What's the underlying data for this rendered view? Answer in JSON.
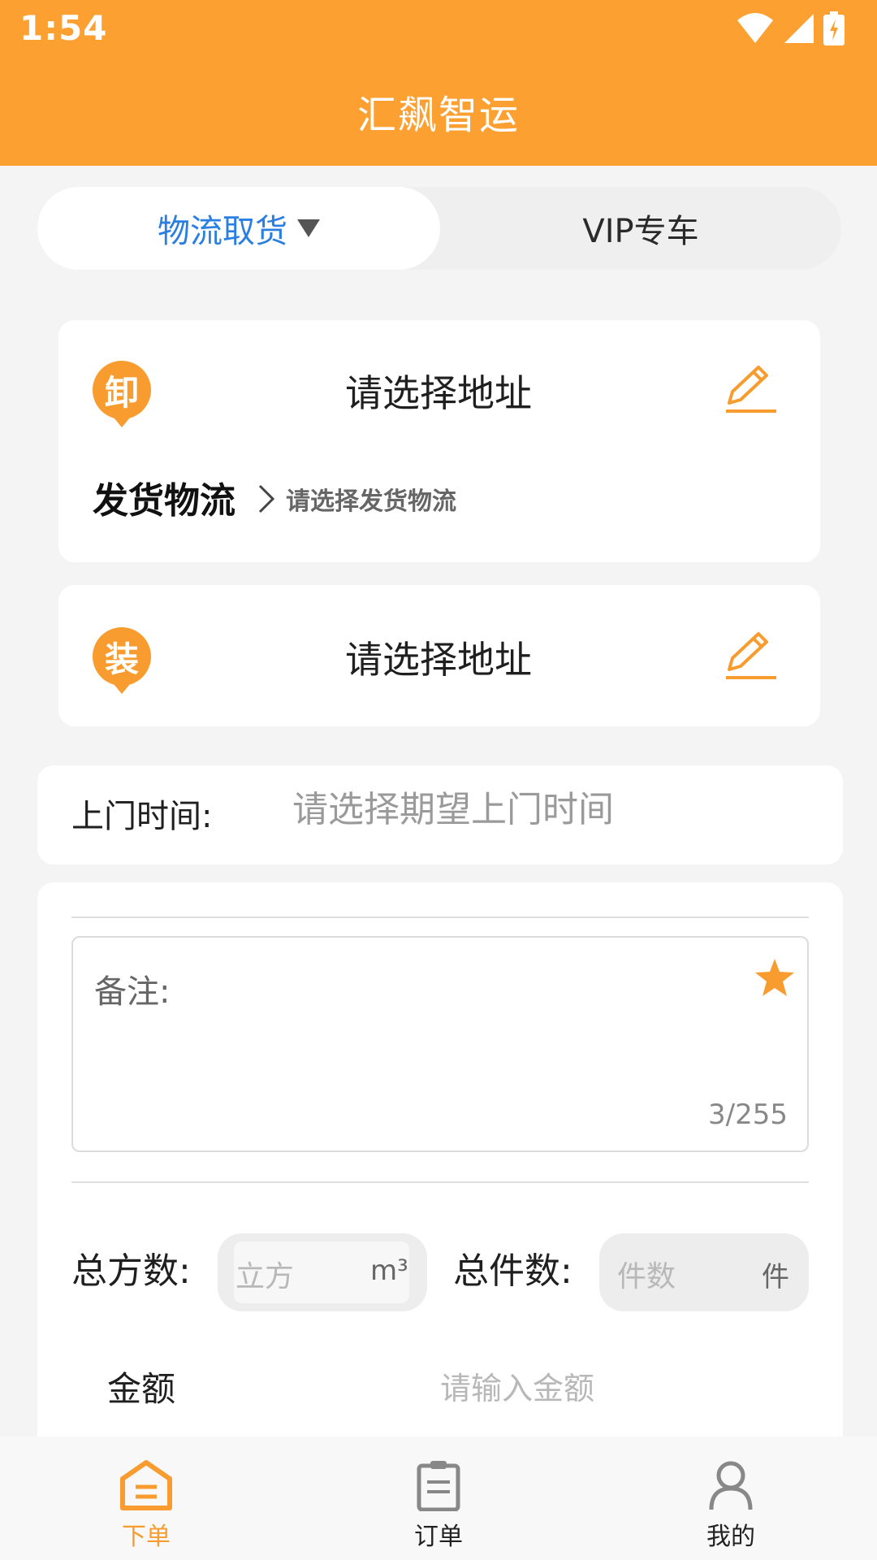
{
  "status_bar": {
    "time": "1:54"
  },
  "app": {
    "title": "汇飙智运"
  },
  "mode_tabs": [
    {
      "label": "物流取货",
      "active": true
    },
    {
      "label": "VIP专车",
      "active": false
    }
  ],
  "unload_card": {
    "badge": "卸",
    "address_placeholder": "请选择地址",
    "shipping_label": "发货物流",
    "shipping_hint": "请选择发货物流"
  },
  "load_card": {
    "badge": "装",
    "address_placeholder": "请选择地址"
  },
  "visit_time": {
    "label": "上门时间:",
    "placeholder": "请选择期望上门时间"
  },
  "notes": {
    "label": "备注:",
    "counter": "3/255"
  },
  "quantities": {
    "volume_label": "总方数:",
    "volume_placeholder": "立方",
    "volume_unit": "m³",
    "pieces_label": "总件数:",
    "pieces_placeholder": "件数",
    "pieces_unit": "件"
  },
  "amount": {
    "label": "金额",
    "placeholder": "请输入金额"
  },
  "bottom_nav": [
    {
      "label": "下单",
      "icon": "home-icon",
      "active": true
    },
    {
      "label": "订单",
      "icon": "clipboard-icon",
      "active": false
    },
    {
      "label": "我的",
      "icon": "user-icon",
      "active": false
    }
  ],
  "colors": {
    "brand": "#fda032",
    "accent": "#f89c2f",
    "active_tab": "#2a7fe0"
  }
}
